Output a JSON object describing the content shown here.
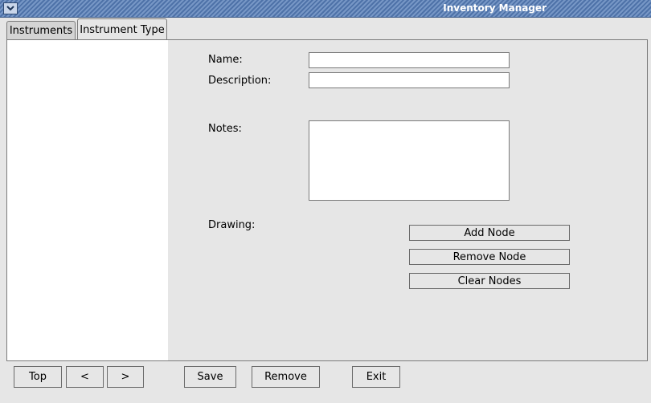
{
  "window": {
    "title": "Inventory Manager",
    "menu_icon": "chevron-down-icon"
  },
  "tabs": [
    {
      "label": "Instruments",
      "selected": false
    },
    {
      "label": "Instrument Type",
      "selected": true
    }
  ],
  "form": {
    "name_label": "Name:",
    "name_value": "",
    "description_label": "Description:",
    "description_value": "",
    "notes_label": "Notes:",
    "notes_value": "",
    "drawing_label": "Drawing:"
  },
  "drawing_buttons": {
    "add_node": "Add Node",
    "remove_node": "Remove Node",
    "clear_nodes": "Clear Nodes"
  },
  "bottom_buttons": {
    "top": "Top",
    "prev": "<",
    "next": ">",
    "save": "Save",
    "remove": "Remove",
    "exit": "Exit"
  }
}
